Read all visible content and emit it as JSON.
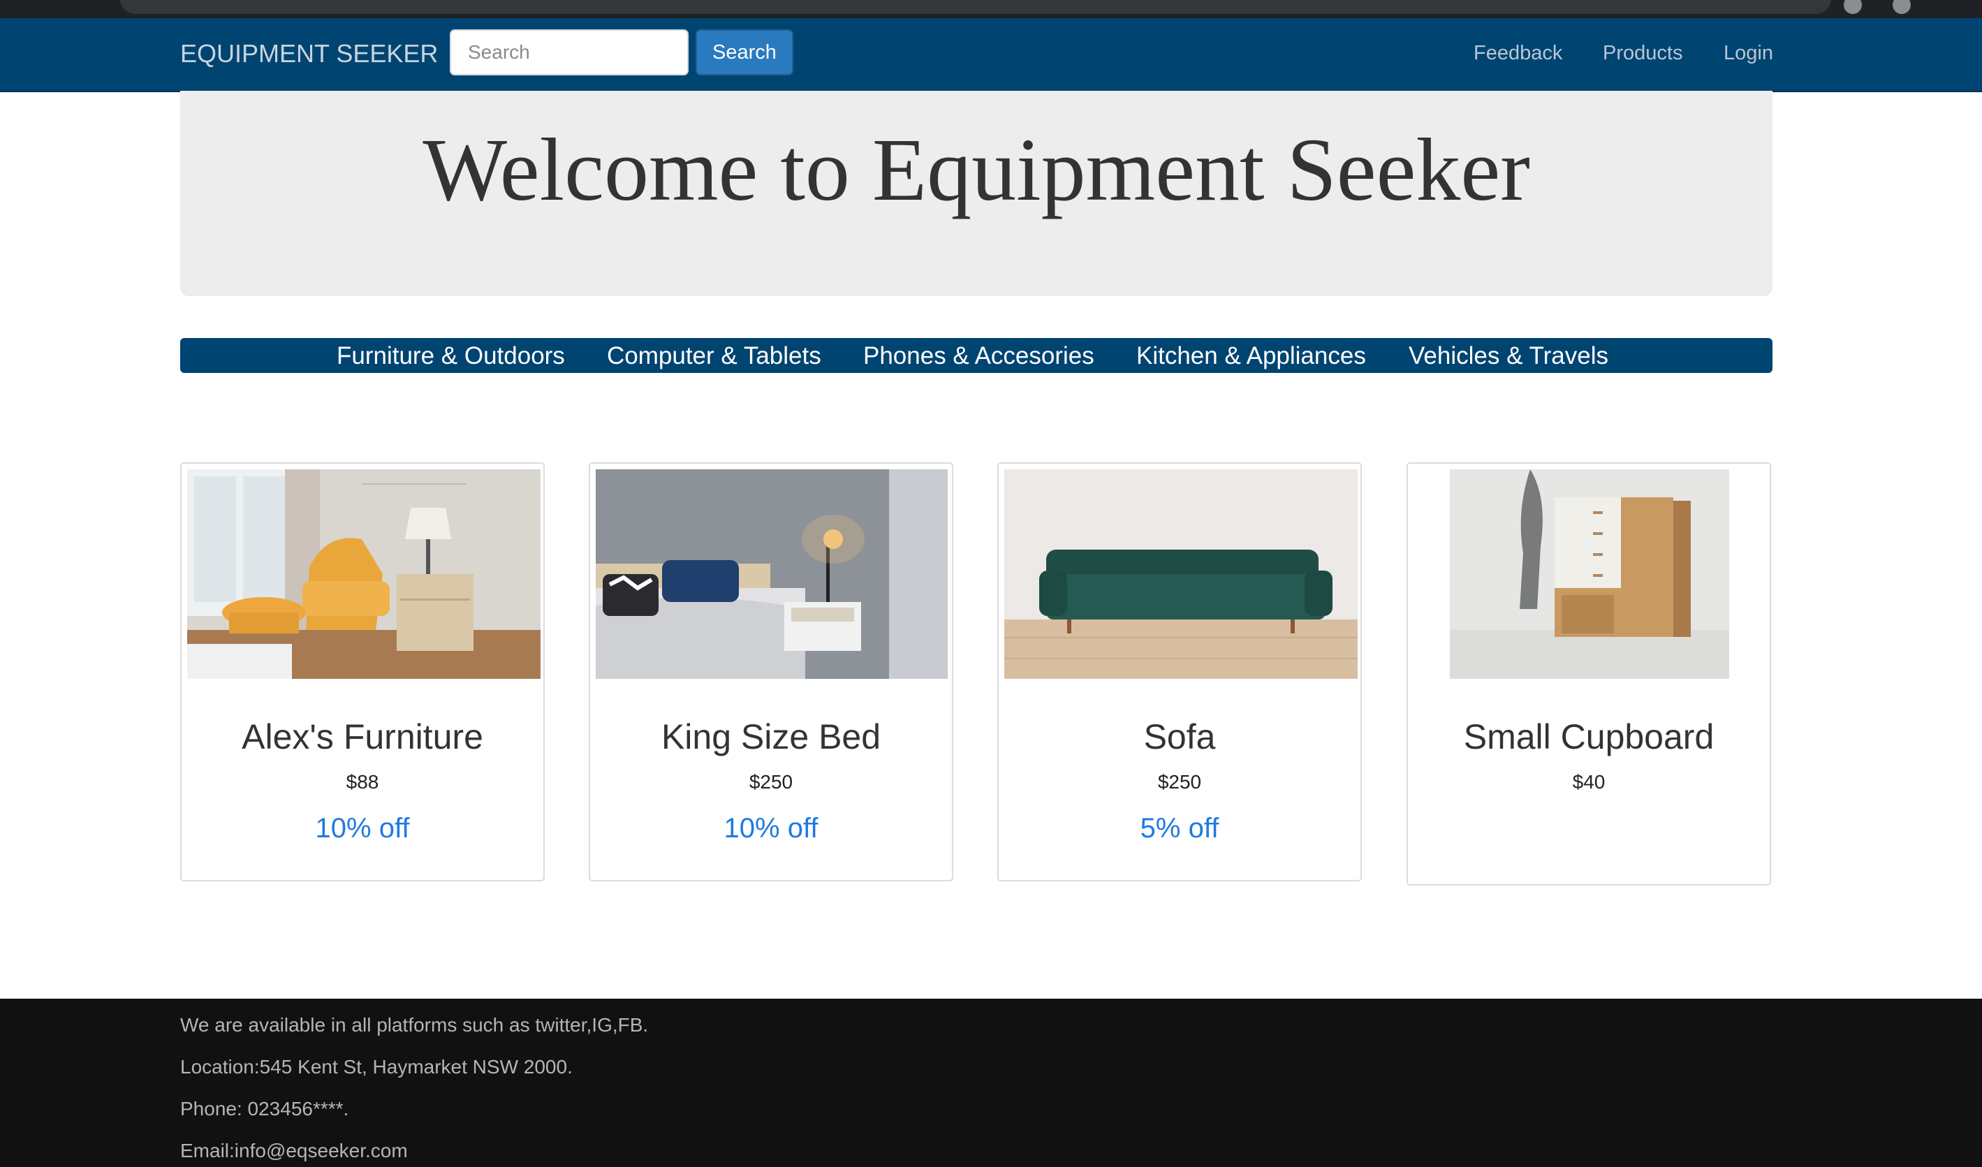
{
  "navbar": {
    "brand": "EQUIPMENT SEEKER",
    "search_placeholder": "Search",
    "search_button": "Search",
    "links": [
      "Feedback",
      "Products",
      "Login"
    ],
    "background": "#004471"
  },
  "hero": {
    "title": "Welcome to Equipment Seeker"
  },
  "categories": [
    "Furniture & Outdoors",
    "Computer & Tablets",
    "Phones & Accesories",
    "Kitchen & Appliances",
    "Vehicles & Travels"
  ],
  "products": [
    {
      "name": "Alex's Furniture",
      "price": "$88",
      "discount": "10% off",
      "image": "armchair-room-photo"
    },
    {
      "name": "King Size Bed",
      "price": "$250",
      "discount": "10% off",
      "image": "bedroom-photo"
    },
    {
      "name": "Sofa",
      "price": "$250",
      "discount": "5% off",
      "image": "green-sofa-photo"
    },
    {
      "name": "Small Cupboard",
      "price": "$40",
      "discount": "",
      "image": "wooden-cupboard-photo"
    }
  ],
  "footer": {
    "lines": [
      "We are available in all platforms such as twitter,IG,FB.",
      "Location:545 Kent St, Haymarket NSW 2000.",
      "Phone: 023456****.",
      "Email:info@eqseeker.com"
    ]
  },
  "colors": {
    "accent": "#004471",
    "discount": "#1f7ae0",
    "footer": "#111111"
  }
}
